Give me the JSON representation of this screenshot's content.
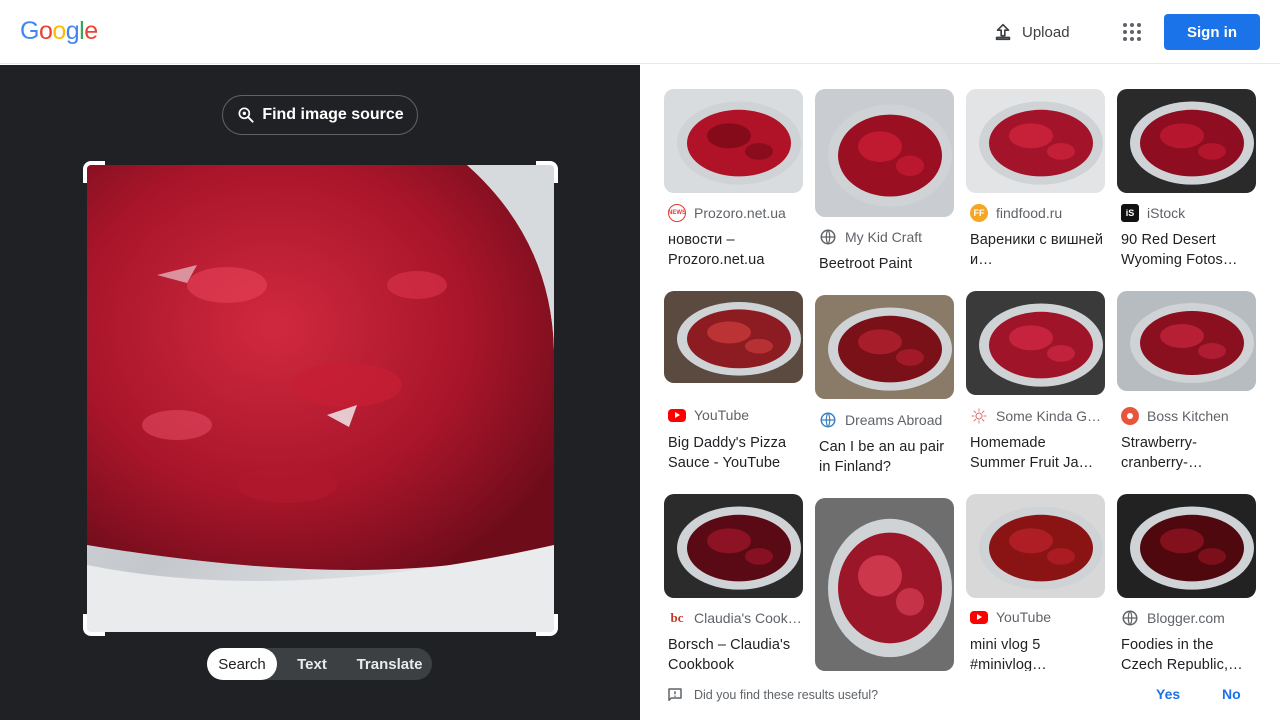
{
  "header": {
    "logo_letters": [
      "G",
      "o",
      "o",
      "g",
      "l",
      "e"
    ],
    "logo_colors": [
      "#4285f4",
      "#ea4335",
      "#fbbc05",
      "#4285f4",
      "#34a853",
      "#ea4335"
    ],
    "upload_label": "Upload",
    "apps_icon": "apps-grid-icon",
    "signin_label": "Sign in"
  },
  "left_pane": {
    "find_source_label": "Find image source",
    "mode_tabs": [
      {
        "label": "Search",
        "active": true
      },
      {
        "label": "Text",
        "active": false
      },
      {
        "label": "Translate",
        "active": false
      }
    ]
  },
  "results": [
    {
      "source": "Prozoro.net.ua",
      "favicon": "news-icon",
      "favicon_color": "#e53935",
      "title": "новости – Prozoro.net.ua"
    },
    {
      "source": "My Kid Craft",
      "favicon": "globe-icon",
      "favicon_color": "#5f6368",
      "title": "Beetroot Paint"
    },
    {
      "source": "findfood.ru",
      "favicon": "findfood-icon",
      "favicon_color": "#f5a623",
      "title": "Вареники с вишней и…"
    },
    {
      "source": "iStock",
      "favicon": "istock-icon",
      "favicon_color": "#111111",
      "title": "90 Red Desert Wyoming Fotos…"
    },
    {
      "source": "YouTube",
      "favicon": "youtube-icon",
      "favicon_color": "#ff0000",
      "title": "Big Daddy's Pizza Sauce - YouTube"
    },
    {
      "source": "Dreams Abroad",
      "favicon": "globe-icon",
      "favicon_color": "#3b82c4",
      "title": "Can I be an au pair in Finland?"
    },
    {
      "source": "Some Kinda G…",
      "favicon": "sun-icon",
      "favicon_color": "#e57373",
      "title": "Homemade Summer Fruit Ja…"
    },
    {
      "source": "Boss Kitchen",
      "favicon": "boss-kitchen-icon",
      "favicon_color": "#e8553d",
      "title": "Strawberry-cranberry-…"
    },
    {
      "source": "Claudia's Cook…",
      "favicon": "bc-icon",
      "favicon_color": "#c0392b",
      "title": "Borsch – Claudia's Cookbook"
    },
    {
      "source": "",
      "favicon": "",
      "favicon_color": "",
      "title": ""
    },
    {
      "source": "YouTube",
      "favicon": "youtube-icon",
      "favicon_color": "#ff0000",
      "title": "mini vlog 5 #minivlog…"
    },
    {
      "source": "Blogger.com",
      "favicon": "globe-icon",
      "favicon_color": "#5f6368",
      "title": "Foodies in the Czech Republic,…"
    }
  ],
  "feedback": {
    "question": "Did you find these results useful?",
    "yes_label": "Yes",
    "no_label": "No"
  }
}
